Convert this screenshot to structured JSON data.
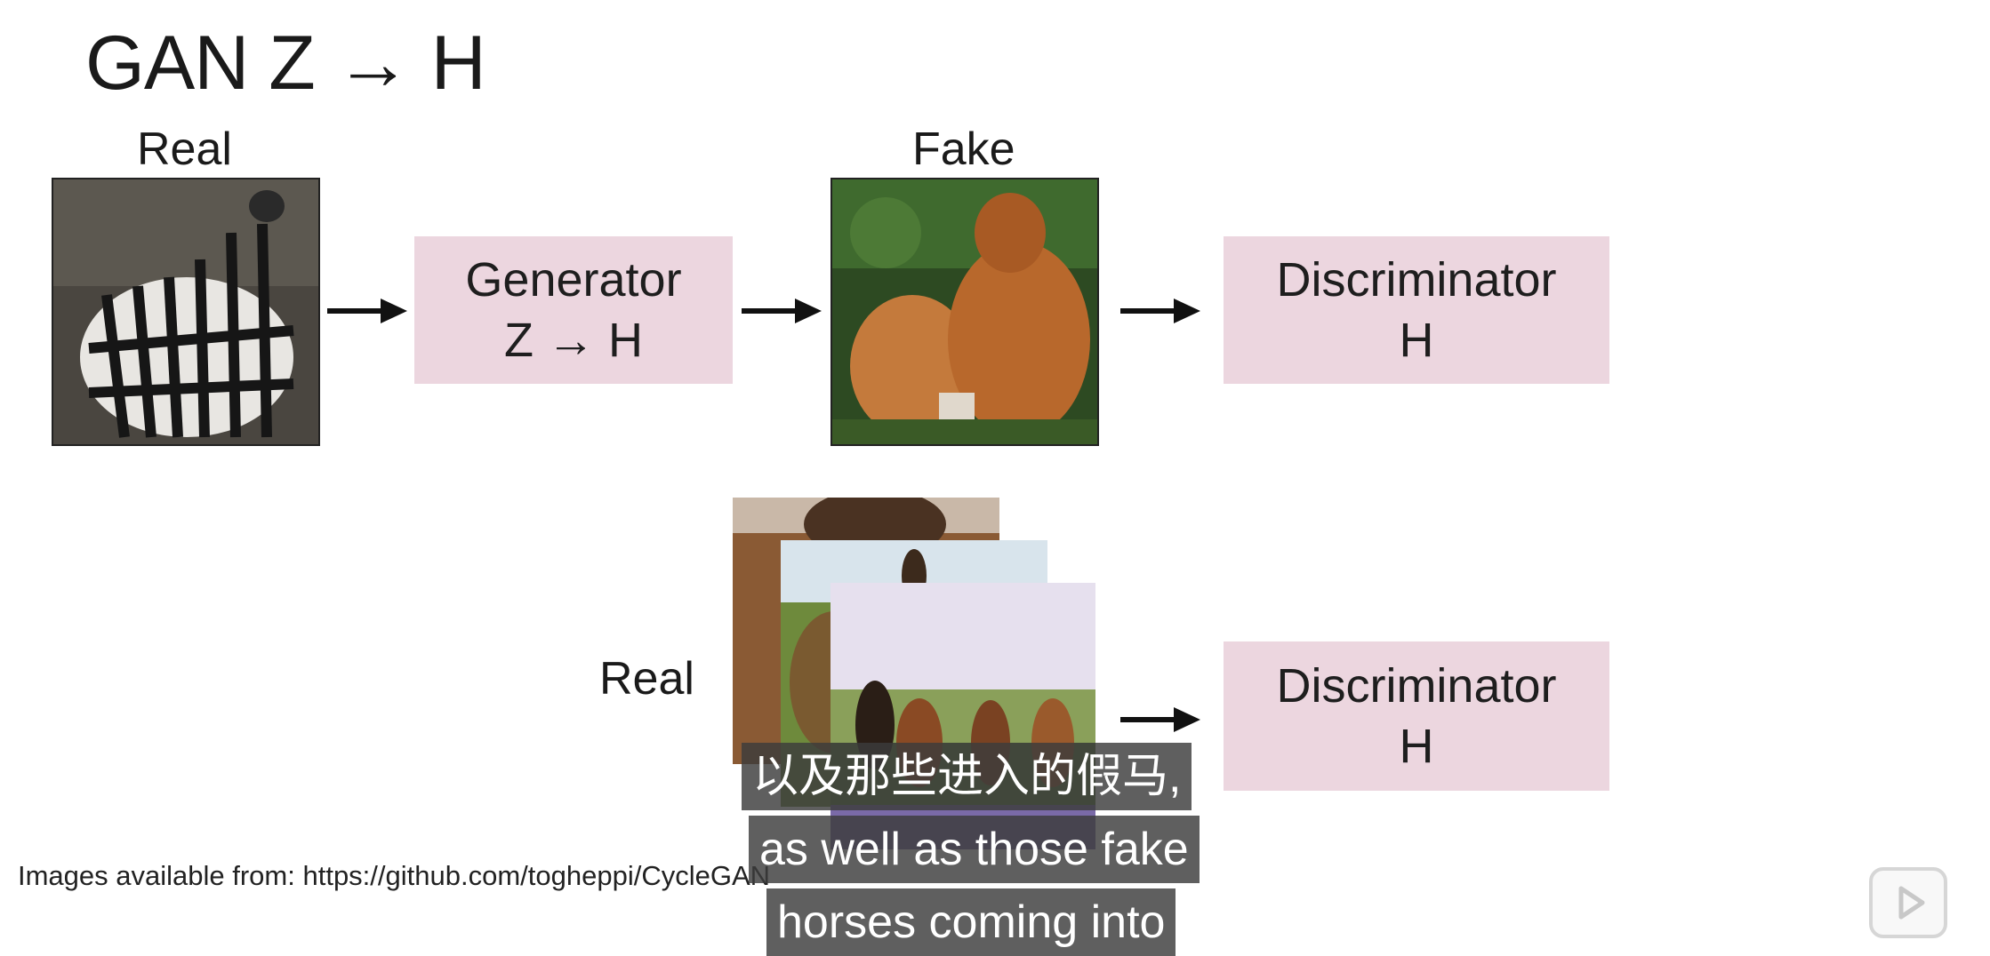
{
  "title": "GAN Z → H",
  "labels": {
    "real_top": "Real",
    "fake": "Fake",
    "real_bottom": "Real"
  },
  "generator": {
    "line1": "Generator",
    "line2": "Z → H"
  },
  "discriminator_top": {
    "line1": "Discriminator",
    "line2": "H"
  },
  "discriminator_bottom": {
    "line1": "Discriminator",
    "line2": "H"
  },
  "footer": "Images available from: https://github.com/togheppi/CycleGAN",
  "subtitles": {
    "zh": "以及那些进入的假马,",
    "en_line1": "as well as those fake",
    "en_line2": "horses coming into"
  },
  "icons": [
    "arrow-right-icon",
    "play-icon"
  ],
  "colors": {
    "box": "#ecd6df",
    "subtitle_bg": "#3c3c3c"
  }
}
